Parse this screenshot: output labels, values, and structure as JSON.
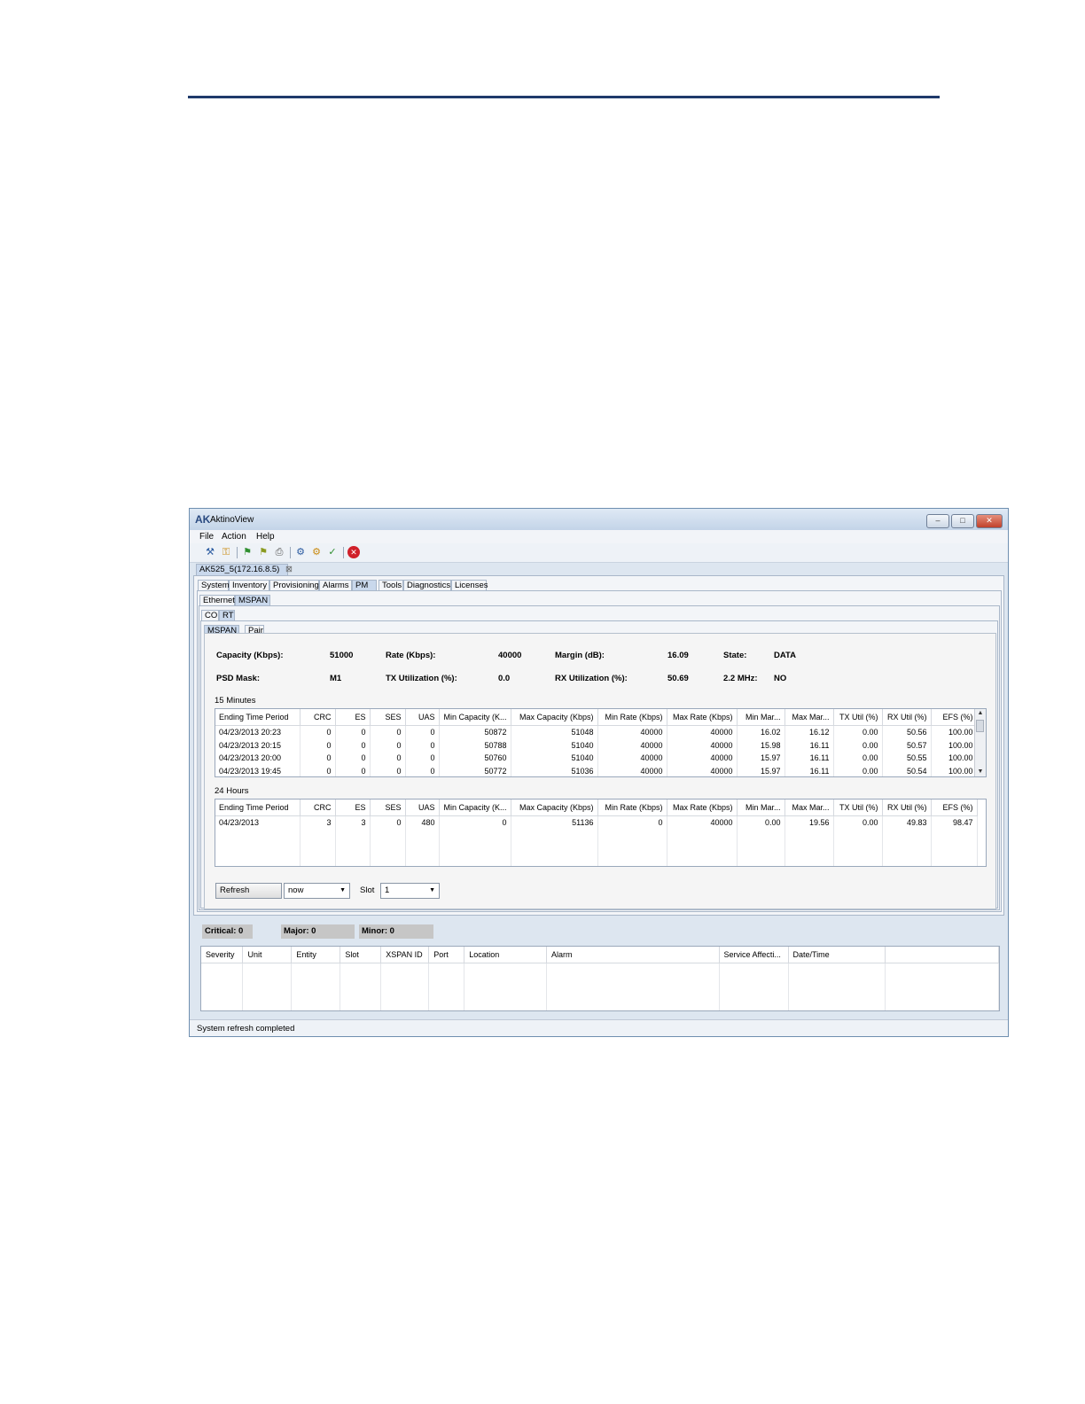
{
  "window": {
    "title": "AktinoView",
    "logo": "AK"
  },
  "menu": [
    "File",
    "Action",
    "Help"
  ],
  "toolbar_icons": [
    "connect-icon",
    "key-icon",
    "flag-green-icon",
    "flag-yellow-icon",
    "printer-icon",
    "wrench-icon",
    "gear-search-icon",
    "check-icon",
    "stop-icon"
  ],
  "device_tab": {
    "label": "AK525_5(172.16.8.5)",
    "close": "⊠"
  },
  "main_tabs": [
    "System",
    "Inventory",
    "Provisioning",
    "Alarms",
    "PM",
    "Tools",
    "Diagnostics",
    "Licenses"
  ],
  "main_tab_active": "PM",
  "sub_tabs": [
    "Ethernet",
    "MSPAN"
  ],
  "side_tabs": [
    "CO",
    "RT"
  ],
  "view_tabs": [
    "MSPAN",
    "Pair"
  ],
  "summary": {
    "capacity_label": "Capacity (Kbps):",
    "capacity_value": "51000",
    "rate_label": "Rate (Kbps):",
    "rate_value": "40000",
    "margin_label": "Margin (dB):",
    "margin_value": "16.09",
    "state_label": "State:",
    "state_value": "DATA",
    "psd_label": "PSD Mask:",
    "psd_value": "M1",
    "tx_label": "TX Utilization (%):",
    "tx_value": "0.0",
    "rx_label": "RX Utilization (%):",
    "rx_value": "50.69",
    "mhz_label": "2.2 MHz:",
    "mhz_value": "NO"
  },
  "columns": [
    "Ending Time Period",
    "CRC",
    "ES",
    "SES",
    "UAS",
    "Min Capacity (K...",
    "Max Capacity (Kbps)",
    "Min Rate (Kbps)",
    "Max Rate (Kbps)",
    "Min Mar...",
    "Max Mar...",
    "TX Util (%)",
    "RX Util (%)",
    "EFS (%)"
  ],
  "fifteen_min": {
    "label": "15 Minutes",
    "rows": [
      [
        "04/23/2013 20:23",
        "0",
        "0",
        "0",
        "0",
        "50872",
        "51048",
        "40000",
        "40000",
        "16.02",
        "16.12",
        "0.00",
        "50.56",
        "100.00"
      ],
      [
        "04/23/2013 20:15",
        "0",
        "0",
        "0",
        "0",
        "50788",
        "51040",
        "40000",
        "40000",
        "15.98",
        "16.11",
        "0.00",
        "50.57",
        "100.00"
      ],
      [
        "04/23/2013 20:00",
        "0",
        "0",
        "0",
        "0",
        "50760",
        "51040",
        "40000",
        "40000",
        "15.97",
        "16.11",
        "0.00",
        "50.55",
        "100.00"
      ],
      [
        "04/23/2013 19:45",
        "0",
        "0",
        "0",
        "0",
        "50772",
        "51036",
        "40000",
        "40000",
        "15.97",
        "16.11",
        "0.00",
        "50.54",
        "100.00"
      ]
    ]
  },
  "twenty_four_hr": {
    "label": "24 Hours",
    "rows": [
      [
        "04/23/2013",
        "3",
        "3",
        "0",
        "480",
        "0",
        "51136",
        "0",
        "40000",
        "0.00",
        "19.56",
        "0.00",
        "49.83",
        "98.47"
      ]
    ]
  },
  "controls": {
    "refresh": "Refresh",
    "period": "now",
    "slot_label": "Slot",
    "slot_value": "1"
  },
  "counters": {
    "critical": "Critical: 0",
    "major": "Major: 0",
    "minor": "Minor: 0"
  },
  "alarm_columns": [
    "Severity",
    "Unit",
    "Entity",
    "Slot",
    "XSPAN ID",
    "Port",
    "Location",
    "Alarm",
    "Service Affecti...",
    "Date/Time"
  ],
  "status": "System refresh completed"
}
